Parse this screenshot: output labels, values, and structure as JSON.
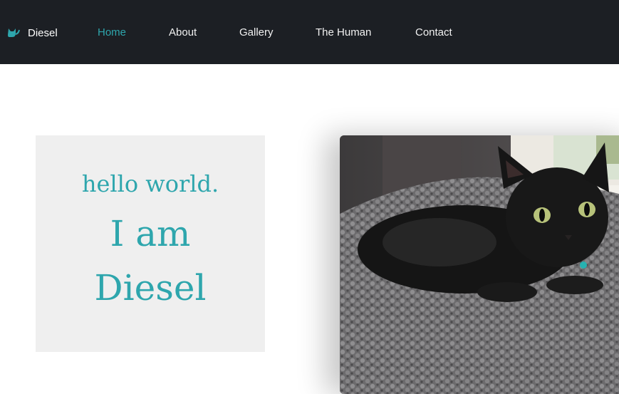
{
  "navbar": {
    "brand_icon": "cat-icon",
    "brand_label": "Diesel",
    "links": [
      {
        "label": "Home",
        "active": true
      },
      {
        "label": "About",
        "active": false
      },
      {
        "label": "Gallery",
        "active": false
      },
      {
        "label": "The Human",
        "active": false
      },
      {
        "label": "Contact",
        "active": false
      }
    ]
  },
  "hero": {
    "greeting": "hello world.",
    "line1": "I am",
    "line2": "Diesel"
  },
  "photo": {
    "subject": "black cat lying in grey fleece bed by a window"
  },
  "colors": {
    "navbar_bg": "#1c1f24",
    "accent": "#2ea6ad",
    "card_bg": "#efefef"
  }
}
